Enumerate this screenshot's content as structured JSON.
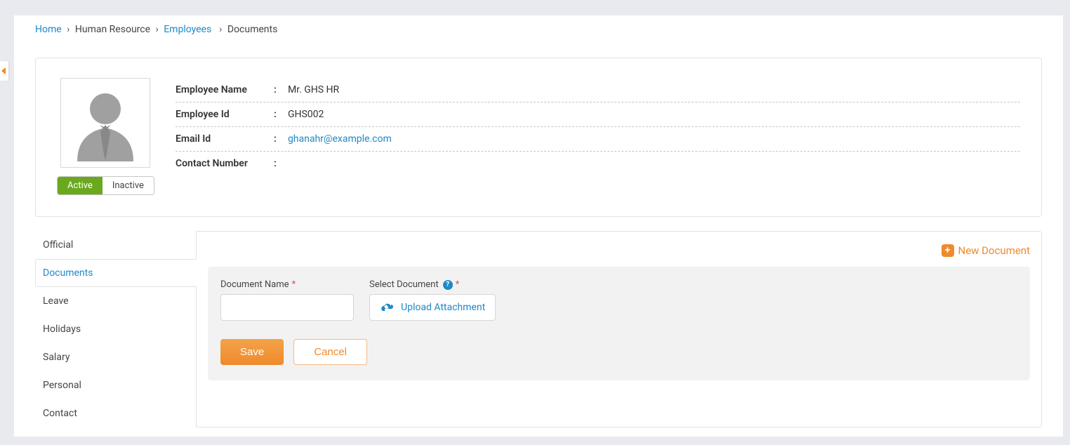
{
  "breadcrumb": {
    "home": "Home",
    "hr": "Human Resource",
    "employees": "Employees",
    "current": "Documents"
  },
  "status": {
    "active": "Active",
    "inactive": "Inactive"
  },
  "employee": {
    "name_label": "Employee Name",
    "name_value": "Mr. GHS HR",
    "id_label": "Employee Id",
    "id_value": "GHS002",
    "email_label": "Email Id",
    "email_value": "ghanahr@example.com",
    "contact_label": "Contact Number",
    "contact_value": ""
  },
  "tabs": {
    "official": "Official",
    "documents": "Documents",
    "leave": "Leave",
    "holidays": "Holidays",
    "salary": "Salary",
    "personal": "Personal",
    "contact": "Contact"
  },
  "panel": {
    "new_document": "New Document",
    "doc_name_label": "Document Name",
    "select_doc_label": "Select Document",
    "upload_label": "Upload Attachment",
    "save": "Save",
    "cancel": "Cancel"
  }
}
